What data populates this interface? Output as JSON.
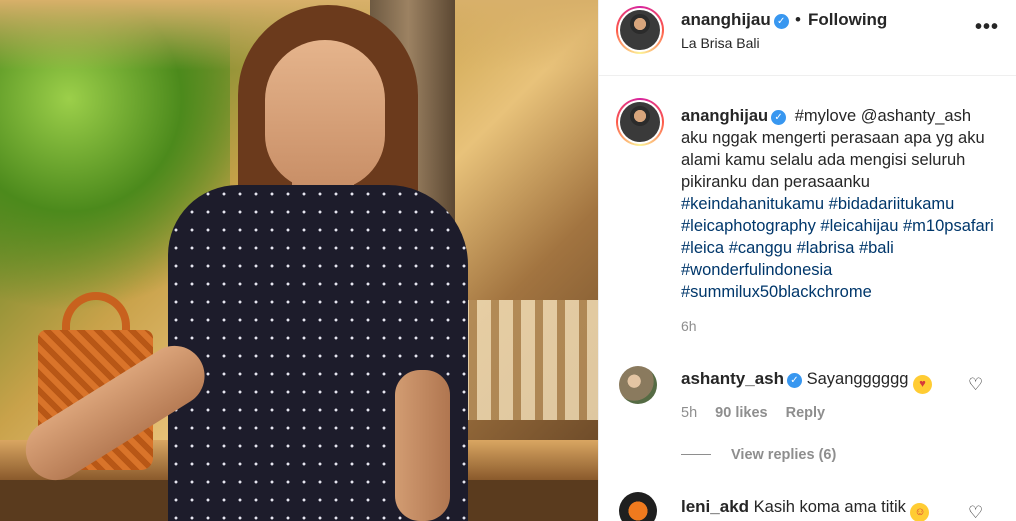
{
  "post": {
    "author": {
      "username": "ananghijau",
      "follow_status": "Following",
      "separator": "•",
      "location": "La Brisa Bali"
    },
    "more_icon": "more-horizontal-icon",
    "caption": {
      "text": "#mylove @ashanty_ash aku nggak mengerti perasaan apa yg aku alami kamu selalu ada mengisi seluruh pikiranku dan perasaanku",
      "hashtags": "#keindahanitukamu #bidadariitukamu #leicaphotography #leicahijau #m10psafari #leica #canggu #labrisa #bali #wonderfulindonesia #summilux50blackchrome",
      "time": "6h"
    }
  },
  "comments": [
    {
      "username": "ashanty_ash",
      "verified": true,
      "text": "Sayangggggg",
      "emoji": "heart-eyes-emoji",
      "time": "5h",
      "likes": "90 likes",
      "reply": "Reply",
      "view_replies": "View replies (6)"
    },
    {
      "username": "leni_akd",
      "verified": false,
      "text": "Kasih koma ama titik",
      "emoji": "grinning-sweat-emoji"
    }
  ],
  "colors": {
    "link": "#00376b",
    "verified": "#3897f0",
    "muted": "#8e8e8e",
    "text": "#262626"
  }
}
